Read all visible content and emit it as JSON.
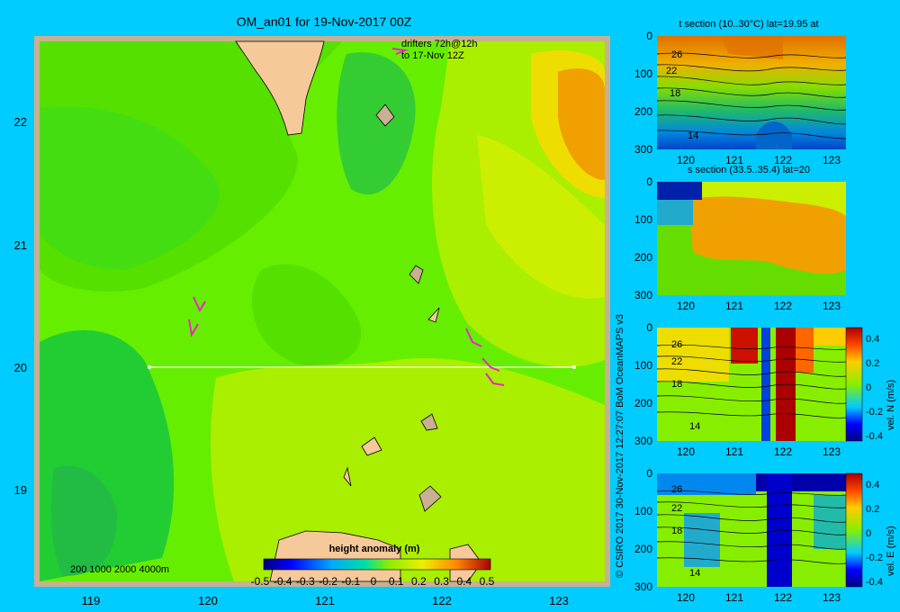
{
  "main_map": {
    "title": "OM_an01 for 19-Nov-2017 00Z",
    "drifters_label_1": "drifters 72h@12h",
    "drifters_label_2": "to 17-Nov 12Z",
    "x_ticks": [
      "119",
      "120",
      "121",
      "122",
      "123"
    ],
    "y_ticks": [
      "22",
      "21",
      "20",
      "19"
    ],
    "depth_legend": "200  1000  2000  4000m",
    "colorbar": {
      "title": "height anomaly  (m)",
      "ticks": [
        "-0.5",
        "-0.4",
        "-0.3",
        "-0.2",
        "-0.1",
        "0",
        "0.1",
        "0.2",
        "0.3",
        "0.4",
        "0.5"
      ]
    },
    "section_line": {
      "lat": 20,
      "lon_from": 119.5,
      "lon_to": 123.2
    }
  },
  "credit": "© CSIRO 2017   30-Nov-2017 12:27:07 BoM OceanMAPS v3",
  "chart_data": [
    {
      "type": "heatmap",
      "title": "OM_an01 for 19-Nov-2017 00Z",
      "variable": "height anomaly (m)",
      "xlim": [
        118.5,
        123.5
      ],
      "ylim": [
        18.3,
        22.7
      ],
      "clim": [
        -0.5,
        0.5
      ],
      "colors": {
        "ocean_main": "#66ee00",
        "ocean_light": "#aaee00",
        "ocean_dark": "#22cc22",
        "high": "#f0a000",
        "land": "#f6c99a"
      }
    },
    {
      "type": "heatmap",
      "title": "t section (10..30°C) lat=19.95 at",
      "x_ticks": [
        "120",
        "121",
        "122",
        "123"
      ],
      "y_ticks": [
        "0",
        "100",
        "200",
        "300"
      ],
      "contour_labels": [
        "26",
        "22",
        "18",
        "14"
      ]
    },
    {
      "type": "heatmap",
      "title": "s section (33.5..35.4) lat=20",
      "x_ticks": [
        "120",
        "121",
        "122",
        "123"
      ],
      "y_ticks": [
        "0",
        "100",
        "200",
        "300"
      ]
    },
    {
      "type": "heatmap",
      "title": "",
      "x_ticks": [
        "120",
        "121",
        "122",
        "123"
      ],
      "y_ticks": [
        "0",
        "100",
        "200",
        "300"
      ],
      "contour_labels": [
        "26",
        "22",
        "18",
        "14"
      ],
      "colorbar_label": "vel. N  (m/s)",
      "colorbar_ticks": [
        "0.4",
        "0.2",
        "0",
        "-0.2",
        "-0.4"
      ]
    },
    {
      "type": "heatmap",
      "title": "",
      "x_ticks": [
        "120",
        "121",
        "122",
        "123"
      ],
      "y_ticks": [
        "0",
        "100",
        "200",
        "300"
      ],
      "contour_labels": [
        "26",
        "22",
        "18",
        "14"
      ],
      "colorbar_label": "vel. E  (m/s)",
      "colorbar_ticks": [
        "0.4",
        "0.2",
        "0",
        "-0.2",
        "-0.4"
      ]
    }
  ]
}
